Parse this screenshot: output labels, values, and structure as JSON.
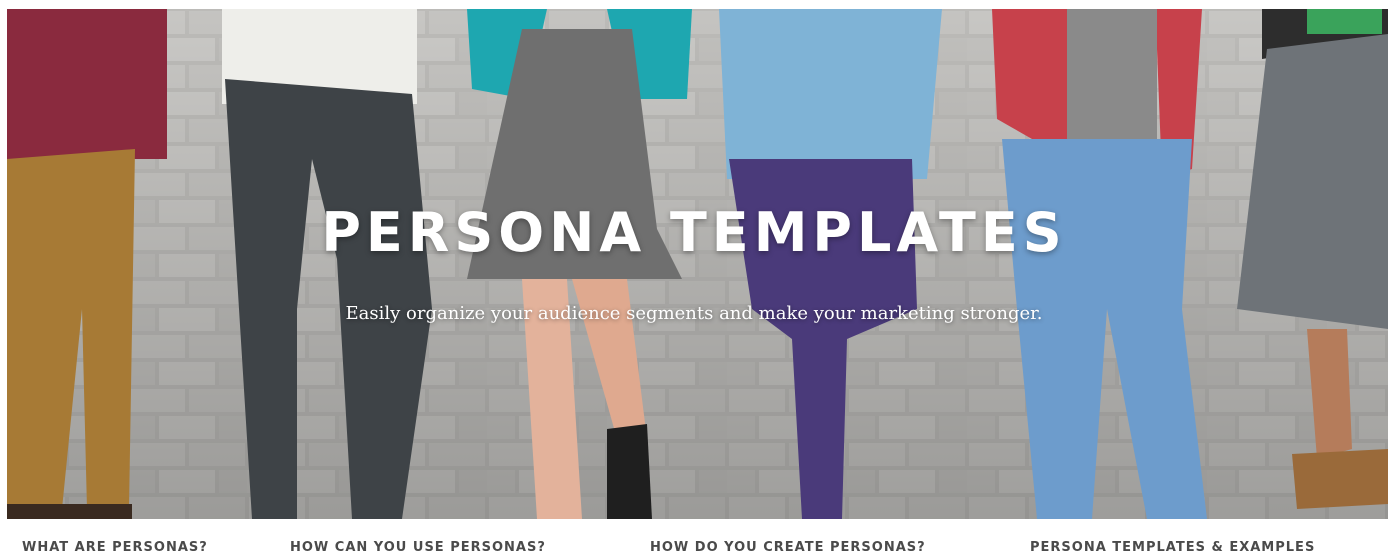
{
  "hero": {
    "title": "PERSONA TEMPLATES",
    "subtitle": "Easily organize your audience segments and make your marketing stronger."
  },
  "nav": {
    "items": [
      {
        "label": "WHAT ARE PERSONAS?"
      },
      {
        "label": "HOW CAN YOU USE PERSONAS?"
      },
      {
        "label": "HOW DO YOU CREATE PERSONAS?"
      },
      {
        "label": "PERSONA TEMPLATES & EXAMPLES"
      }
    ]
  },
  "colors": {
    "brick_wall": "#c4c3c0",
    "hero_text": "#ffffff",
    "nav_text": "#4a4a4a"
  }
}
